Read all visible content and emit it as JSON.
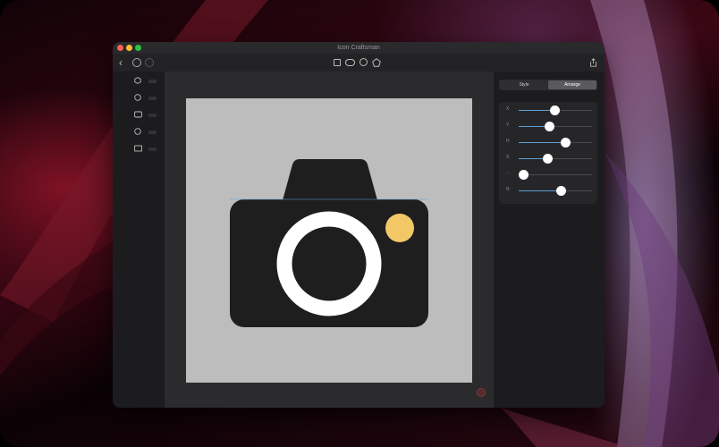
{
  "window": {
    "title": "Icon Craftsman"
  },
  "toolbar": {
    "back_icon": "chevron-left-icon",
    "history_icon": "clock-arrow-icon",
    "redo_icon": "clock-arrow-icon",
    "shape_tools": [
      "square",
      "rounded-rect",
      "circle",
      "pentagon"
    ],
    "share_icon": "share-icon"
  },
  "sidebar": {
    "layers": [
      {
        "shape": "hexagon"
      },
      {
        "shape": "circle"
      },
      {
        "shape": "rounded-rect"
      },
      {
        "shape": "circle"
      },
      {
        "shape": "rect"
      }
    ]
  },
  "artboard": {
    "background": "#bdbdbd",
    "icon": "camera",
    "body_color": "#1e1e1e",
    "lens_ring_color": "#ffffff",
    "flash_color": "#f2c867"
  },
  "inspector": {
    "tabs": [
      {
        "label": "Style",
        "active": false
      },
      {
        "label": "Arrange",
        "active": true
      }
    ],
    "sliders": [
      {
        "label": "X",
        "value": 0.49
      },
      {
        "label": "Y",
        "value": 0.41
      },
      {
        "label": "H",
        "value": 0.64
      },
      {
        "label": "S",
        "value": 0.39
      },
      {
        "label": "◌",
        "value": 0.06
      },
      {
        "label": "R",
        "value": 0.57
      }
    ],
    "accent": "#5aa0d8"
  }
}
